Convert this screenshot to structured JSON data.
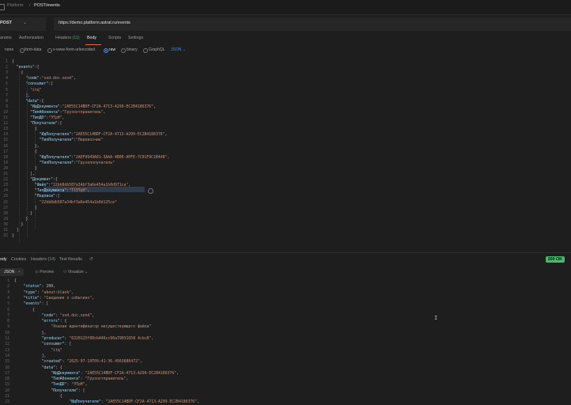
{
  "topbar": {
    "breadcrumb_parent": "Platform",
    "separator": "/",
    "breadcrumb_current": "POST/events"
  },
  "request": {
    "method": "POST",
    "url": "https://demo.platform.astral.ru/events",
    "tabs": [
      {
        "label": "arams",
        "count": ""
      },
      {
        "label": "Authorization",
        "count": ""
      },
      {
        "label": "Headers",
        "count": "(11)"
      },
      {
        "label": "Body",
        "count": ""
      },
      {
        "label": "Scripts",
        "count": ""
      },
      {
        "label": "Settings",
        "count": ""
      }
    ],
    "body_options": [
      "none",
      "form-data",
      "x-www-form-urlencoded",
      "raw",
      "binary",
      "GraphQL"
    ],
    "body_selected": "raw",
    "body_format": "JSON",
    "body_lines": [
      [
        "1",
        "{"
      ],
      [
        "2",
        "  \"events\":["
      ],
      [
        "3",
        "    {"
      ],
      [
        "4",
        "      \"code\":\"sod.doc.send\","
      ],
      [
        "5",
        "      \"consumer\":["
      ],
      [
        "6",
        "        \"itq\""
      ],
      [
        "7",
        "      ],"
      ],
      [
        "8",
        "      \"data\":{"
      ],
      [
        "9",
        "        \"ИдДокумента\":\"2AE55C14BDF-CF2A-4713-A299-EC2B4186376\","
      ],
      [
        "10",
        "        \"ТипАбонента\":\"Грузоотправитель\","
      ],
      [
        "11",
        "        \"ТипДО\":\"ЭТрН\","
      ],
      [
        "12",
        "        \"Получатели\":["
      ],
      [
        "13",
        "          {"
      ],
      [
        "14",
        "            \"ИдПолучателя\":\"2AE55C14BDF-CF2A-4713-A299-EC2B4186376\","
      ],
      [
        "15",
        "            \"ТипПолучателя\":\"Перевозчик\""
      ],
      [
        "16",
        "          },"
      ],
      [
        "17",
        "          {"
      ],
      [
        "18",
        "            \"ИдПолучателя\":\"2AEF9949A01-3AAA-4B0E-APFE-7C01F9C1B448\","
      ],
      [
        "19",
        "            \"ТипПолучателя\":\"Грузополучатель\""
      ],
      [
        "20",
        "          }"
      ],
      [
        "21",
        "        ],"
      ],
      [
        "22",
        "        \"Документ\":{"
      ],
      [
        "23",
        "          \"Файл\":\"22bb8db587a34bf3a6e454a1b0d971ca\","
      ],
      [
        "24",
        "          \"ТипДокумента\":\"Т1ЭТрН\","
      ],
      [
        "25",
        "          \"Подписи\":["
      ],
      [
        "26",
        "            \"22bb8db587a34bf3a6e454a1b0d125ce\""
      ],
      [
        "27",
        "          ]"
      ],
      [
        "28",
        "        }"
      ],
      [
        "29",
        "      }"
      ],
      [
        "30",
        "    }"
      ],
      [
        "31",
        "  ]"
      ],
      [
        "32",
        "}"
      ]
    ]
  },
  "response": {
    "tabs": [
      {
        "label": "ody",
        "count": ""
      },
      {
        "label": "Cookies",
        "count": ""
      },
      {
        "label": "Headers",
        "count": "(14)"
      },
      {
        "label": "Test Results",
        "count": ""
      }
    ],
    "status": "200 OK",
    "format": "JSON",
    "preview_label": "Preview",
    "visualize_label": "Visualize",
    "body_lines": [
      [
        "1",
        "{"
      ],
      [
        "2",
        "    \"status\": 200,"
      ],
      [
        "3",
        "    \"type\": \"about:blank\","
      ],
      [
        "4",
        "    \"title\": \"Сведения о событиях\","
      ],
      [
        "5",
        "    \"events\": ["
      ],
      [
        "6",
        "        {"
      ],
      [
        "7",
        "            \"code\": \"sod.doc.send\","
      ],
      [
        "8",
        "            \"errors\": {"
      ],
      [
        "9",
        "                \"Указан идентификатор несуществующего файла\""
      ],
      [
        "10",
        "            },"
      ],
      [
        "11",
        "            \"producer\": \"6320125f08cb446cc96a79031658 4cbc8\","
      ],
      [
        "12",
        "            \"consumer\": ["
      ],
      [
        "13",
        "                \"itq\""
      ],
      [
        "14",
        "            ],"
      ],
      [
        "15",
        "            \"created\": \"2025-07-19T09:41:36.4563686472\","
      ],
      [
        "16",
        "            \"data\": {"
      ],
      [
        "17",
        "                \"ИдДокумента\": \"2AE55C14BDF-CF2A-4713-A299-EC2B4186376\","
      ],
      [
        "18",
        "                \"ТипАбонента\": \"Грузоотправитель\","
      ],
      [
        "19",
        "                \"ТипДО\": \"ЭТрН\","
      ],
      [
        "20",
        "                \"Получатели\": ["
      ],
      [
        "21",
        "                    {"
      ],
      [
        "22",
        "                        \"ИдПолучателя\": \"2AE55C14BDF-CF2A-4713-A299-EC2B4186376\","
      ]
    ]
  }
}
